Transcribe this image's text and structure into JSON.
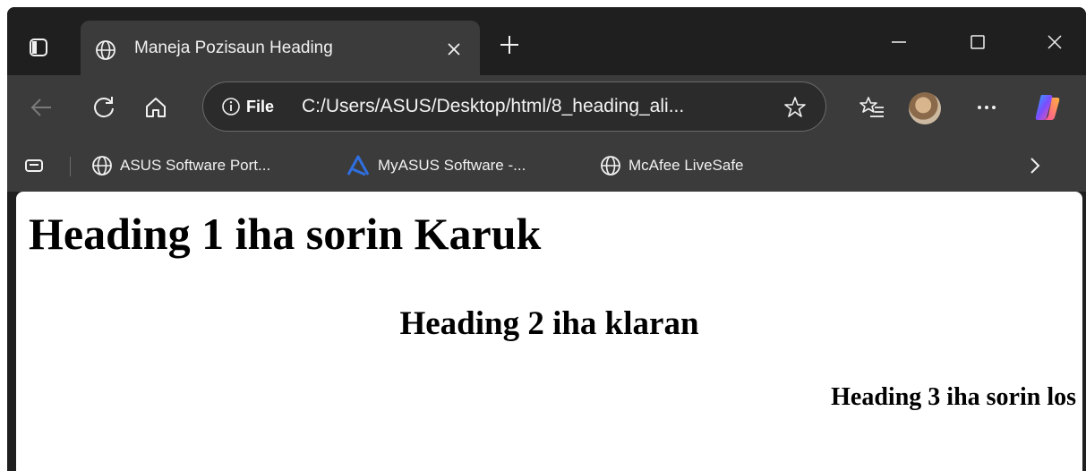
{
  "browser": {
    "tab": {
      "title": "Maneja Pozisaun Heading",
      "favicon": "globe-icon"
    },
    "address_bar": {
      "scheme_label": "File",
      "url": "C:/Users/ASUS/Desktop/html/8_heading_ali..."
    },
    "favorites": [
      {
        "label": "ASUS Software Port...",
        "icon": "globe-icon"
      },
      {
        "label": "MyASUS Software -...",
        "icon": "myasus-logo-icon"
      },
      {
        "label": "McAfee LiveSafe",
        "icon": "globe-icon"
      }
    ],
    "colors": {
      "frame": "#1f1f1f",
      "toolbar": "#3b3b3b",
      "text": "#f1f1f1",
      "myasus_blue": "#2f6fe0"
    }
  },
  "page": {
    "heading1": "Heading 1 iha sorin Karuk",
    "heading2": "Heading 2 iha klaran",
    "heading3": "Heading 3 iha sorin los"
  }
}
